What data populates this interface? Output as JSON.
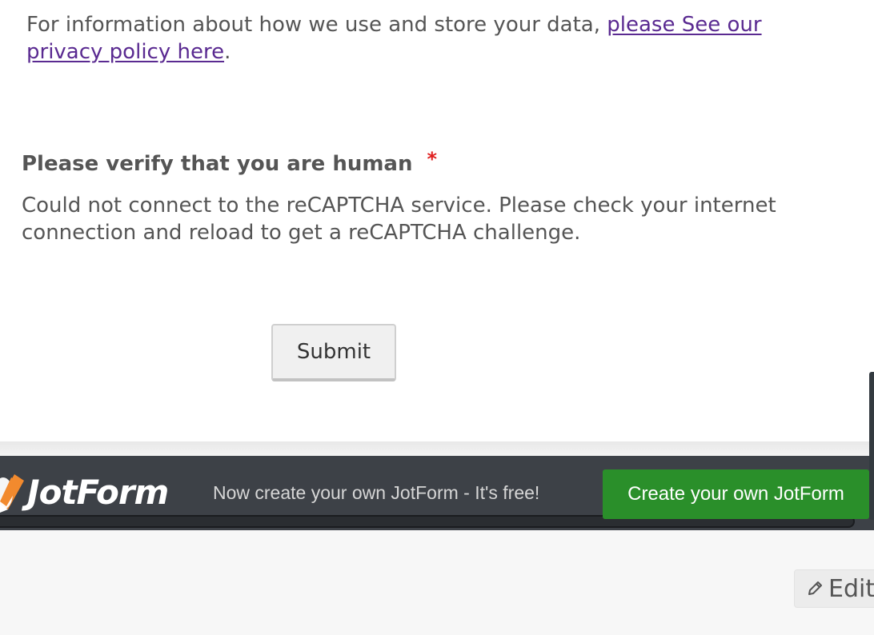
{
  "form": {
    "privacy_text": "For information about how we use and store your data,",
    "privacy_link": "please See our privacy policy here",
    "privacy_end": ".",
    "verify_label": "Please verify that you are human",
    "required_mark": "*",
    "captcha_error": "Could not connect to the reCAPTCHA service. Please check your internet connection and reload to get a reCAPTCHA challenge.",
    "submit_label": "Submit"
  },
  "banner": {
    "logo_text": "JotForm",
    "tagline": "Now create your own JotForm - It's free!",
    "cta_label": "Create your own JotForm",
    "cta_color": "#2a8f2a"
  },
  "footer": {
    "edit_label": "Edit",
    "edit_icon": "pencil-icon"
  },
  "colors": {
    "link": "#5a2a91",
    "required": "#e02020",
    "banner_bg": "#3d4147"
  }
}
